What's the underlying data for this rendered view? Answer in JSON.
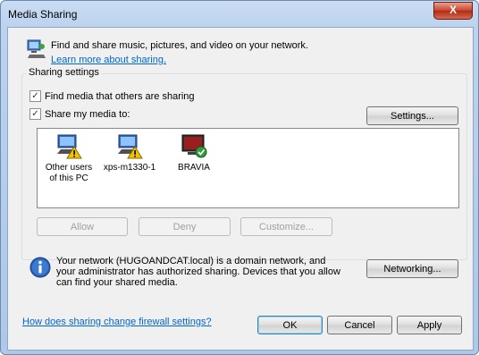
{
  "window": {
    "title": "Media Sharing",
    "close_label": "X"
  },
  "header": {
    "text": "Find and share music, pictures, and video on your network.",
    "link": "Learn more about sharing."
  },
  "sharing": {
    "group_label": "Sharing settings",
    "find_media_label": "Find media that others are sharing",
    "share_media_label": "Share my media to:",
    "find_media_checked": true,
    "share_media_checked": true,
    "settings_button": "Settings..."
  },
  "devices": [
    {
      "name": "Other users of this PC"
    },
    {
      "name": "xps-m1330-1"
    },
    {
      "name": "BRAVIA"
    }
  ],
  "device_actions": {
    "allow": "Allow",
    "deny": "Deny",
    "customize": "Customize..."
  },
  "info": {
    "text": "Your network (HUGOANDCAT.local) is a domain network, and your administrator has authorized sharing. Devices that you allow can find your shared media.",
    "networking_button": "Networking..."
  },
  "footer": {
    "firewall_link": "How does sharing change firewall settings?",
    "ok": "OK",
    "cancel": "Cancel",
    "apply": "Apply"
  }
}
